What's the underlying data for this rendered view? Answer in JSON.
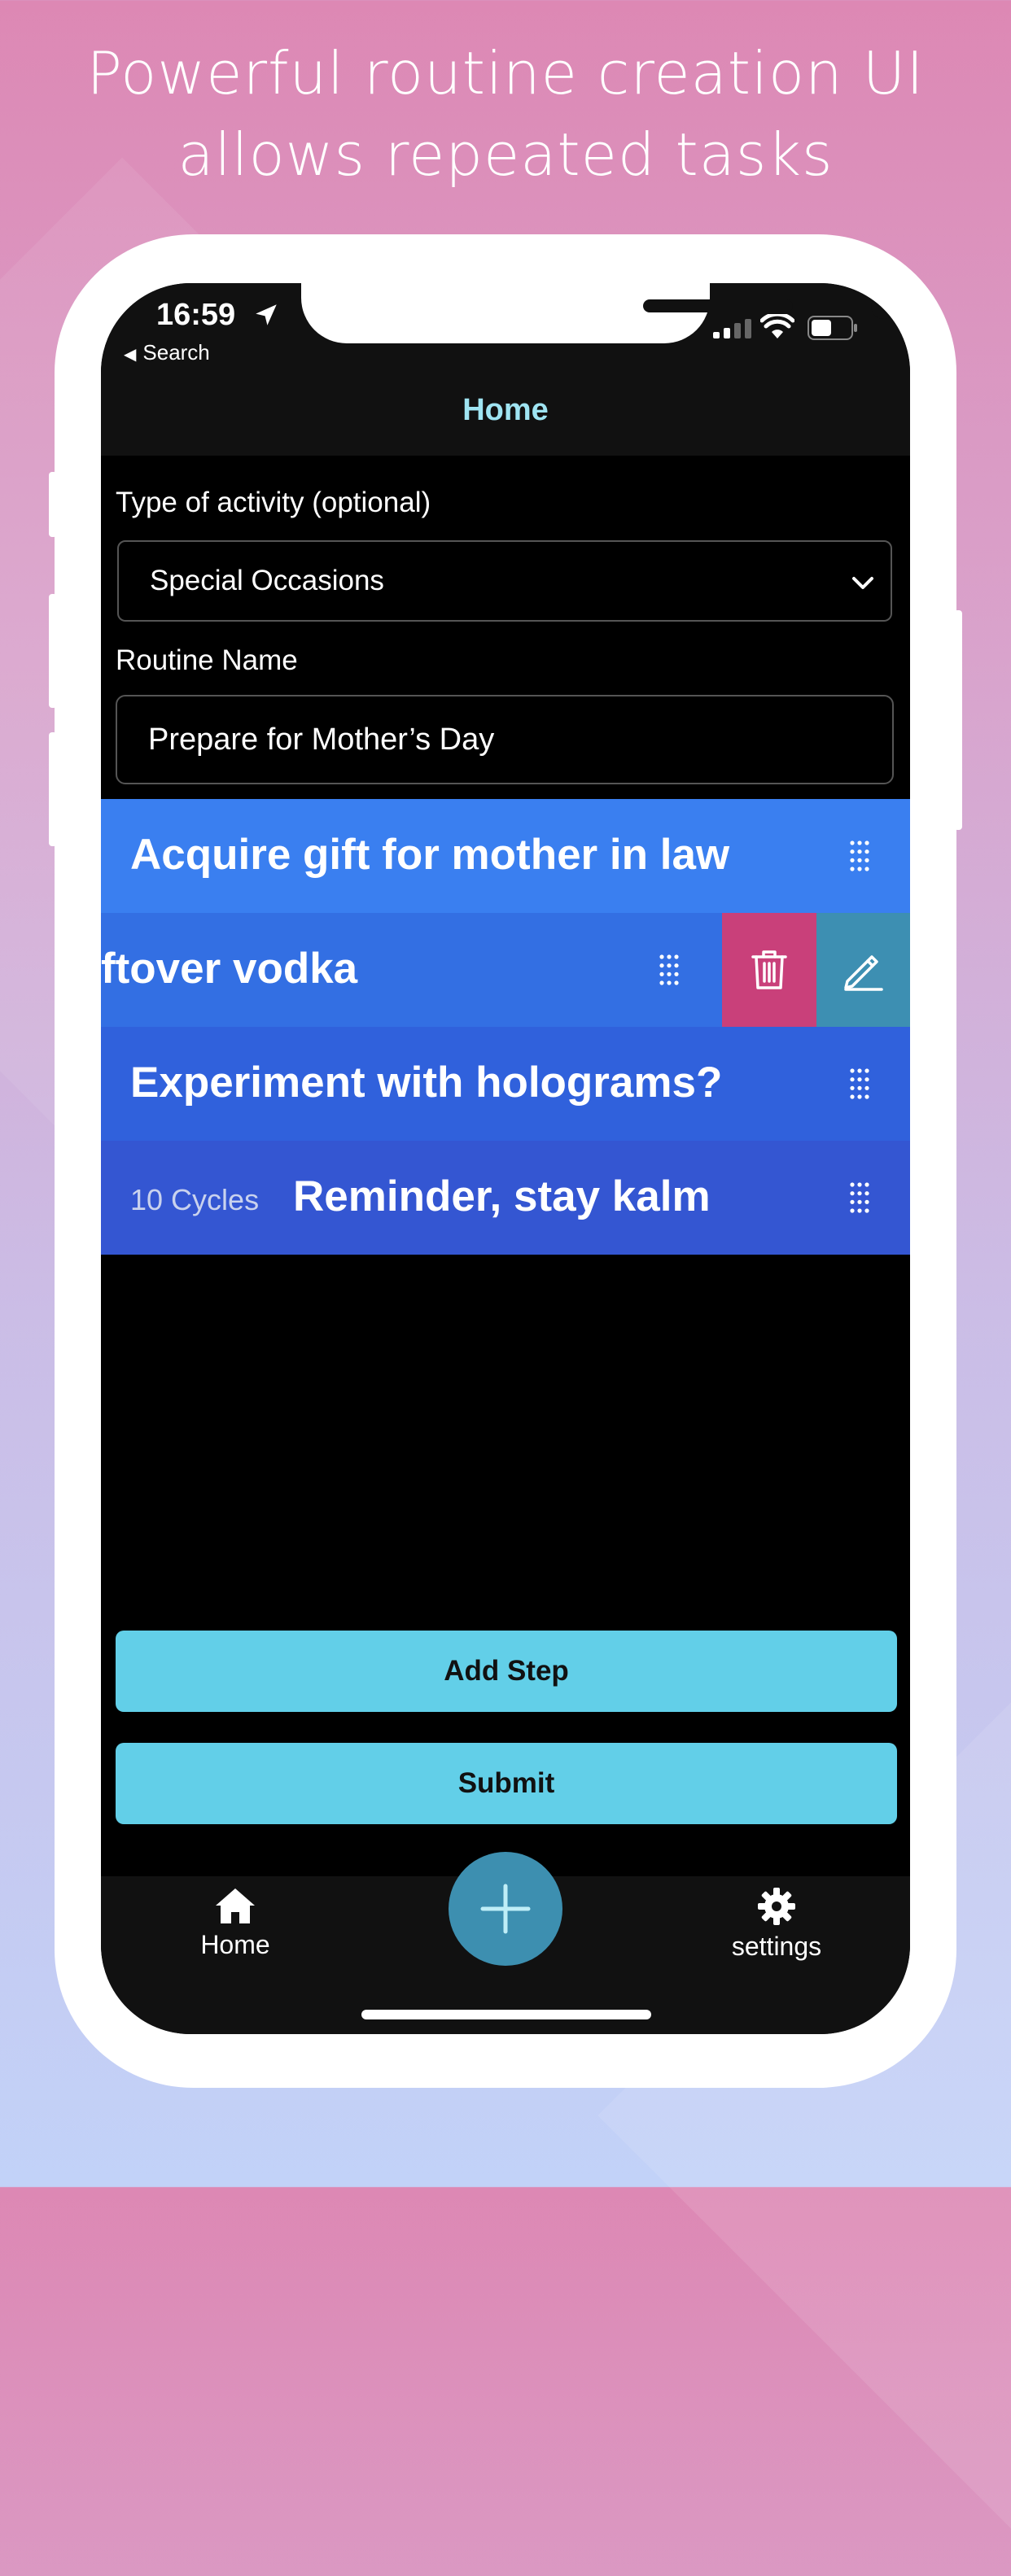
{
  "promo": {
    "headline_line1": "Powerful routine creation UI",
    "headline_line2": "allows repeated tasks"
  },
  "status_bar": {
    "time": "16:59",
    "back_label": "Search"
  },
  "nav": {
    "title": "Home"
  },
  "form": {
    "activity_label": "Type of activity (optional)",
    "activity_value": "Special Occasions",
    "routine_label": "Routine Name",
    "routine_value": "Prepare for Mother’s Day"
  },
  "steps": [
    {
      "title": "Acquire gift for mother in law",
      "color": "#3a7ff0"
    },
    {
      "title": "ftover vodka",
      "color": "#336fe3",
      "swiped": true
    },
    {
      "title": "Experiment with holograms?",
      "color": "#3061dc"
    },
    {
      "cycles": "10 Cycles",
      "title": "Reminder, stay kalm",
      "color": "#3456d2"
    }
  ],
  "actions": {
    "delete_icon": "trash-icon",
    "edit_icon": "pencil-icon",
    "delete_color": "#c9407a",
    "edit_color": "#3d8fb2"
  },
  "buttons": {
    "add_step": "Add Step",
    "submit": "Submit"
  },
  "tabbar": {
    "home_label": "Home",
    "settings_label": "settings",
    "fab_icon": "plus-icon"
  },
  "colors": {
    "accent": "#62cfe8",
    "nav_title": "#9fe4f2",
    "fab": "#3d8fb0"
  }
}
